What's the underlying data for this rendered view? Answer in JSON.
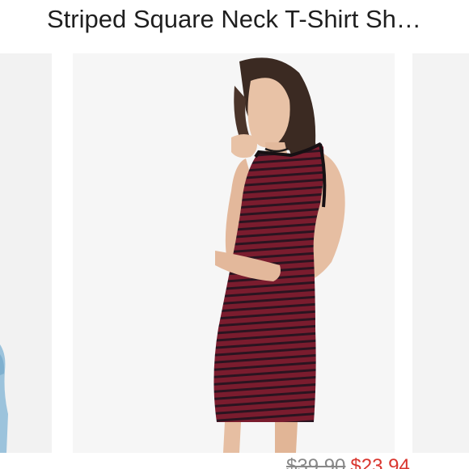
{
  "listing": {
    "title": "Striped Square Neck T-Shirt Sh…"
  },
  "carousel": {
    "current_image": "product-photo-model-striped-dress",
    "colors": {
      "dress": "#7a1c2e",
      "stripe": "#2a1420",
      "background": "#f6f6f6"
    }
  },
  "pricing": {
    "original": "$39.90",
    "sale": "$23.94",
    "sale_color": "#d9362f",
    "original_color": "#888888"
  }
}
